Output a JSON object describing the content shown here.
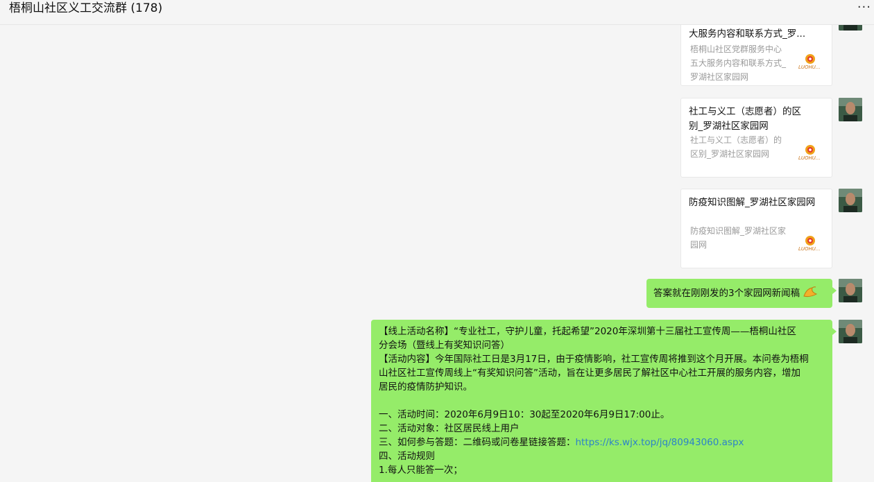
{
  "header": {
    "title": "梧桐山社区义工交流群 (178)",
    "more": "···"
  },
  "messages": {
    "card1": {
      "title": "大服务内容和联系方式_罗...",
      "desc": [
        "梧桐山社区党群服务中心",
        "五大服务内容和联系方式_",
        "罗湖社区家园网"
      ]
    },
    "card2": {
      "title": [
        "社工与义工（志愿者）的区",
        "别_罗湖社区家园网"
      ],
      "desc": [
        "社工与义工（志愿者）的",
        "区别_罗湖社区家园网"
      ]
    },
    "card3": {
      "title": "防疫知识图解_罗湖社区家园网",
      "desc": [
        "防疫知识图解_罗湖社区家",
        "园网"
      ]
    },
    "text1": "答案就在刚刚发的3个家园网新闻稿",
    "text2": {
      "lines": [
        "【线上活动名称】“专业社工，守护儿童，托起希望”2020年深圳第十三届社工宣传周——梧桐山社区",
        "分会场（暨线上有奖知识问答）",
        "【活动内容】今年国际社工日是3月17日，由于疫情影响，社工宣传周将推到这个月开展。本问卷为梧桐",
        "山社区社工宣传周线上“有奖知识问答”活动，旨在让更多居民了解社区中心社工开展的服务内容，增加",
        "居民的疫情防护知识。",
        "",
        "一、活动时间：2020年6月9日10：30起至2020年6月9日17:00止。",
        "二、活动对象：社区居民线上用户",
        "四、活动规则",
        "1.每人只能答一次；"
      ],
      "line_how_prefix": "三、如何参与答题：二维码或问卷星链接答题：",
      "link": "https://ks.wjx.top/jq/80943060.aspx"
    }
  },
  "logo_text": "LUOHU..."
}
